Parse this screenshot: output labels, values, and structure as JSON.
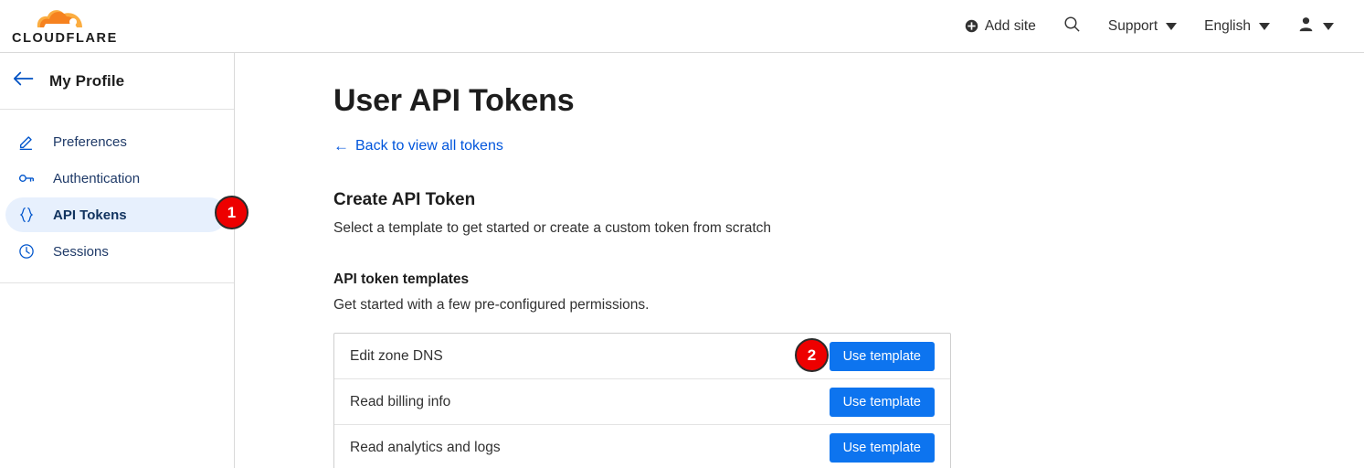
{
  "header": {
    "logo_name": "cloudflare-logo",
    "logo_text": "CLOUDFLARE",
    "logo_colors": {
      "cloud_dark": "#f6821f",
      "cloud_light": "#fbad41",
      "wordmark": "#1d1d1d"
    },
    "nav": [
      {
        "id": "add-site",
        "label": "Add site",
        "icon": "plus-circle-icon",
        "caret": false
      },
      {
        "id": "search",
        "label": "",
        "icon": "search-icon",
        "caret": false
      },
      {
        "id": "support",
        "label": "Support",
        "icon": "",
        "caret": true
      },
      {
        "id": "language",
        "label": "English",
        "icon": "",
        "caret": true
      },
      {
        "id": "account",
        "label": "",
        "icon": "user-icon",
        "caret": true
      }
    ]
  },
  "sidebar": {
    "back_icon": "arrow-left-icon",
    "title": "My Profile",
    "items": [
      {
        "id": "preferences",
        "label": "Preferences",
        "icon": "pencil-icon",
        "selected": false
      },
      {
        "id": "authentication",
        "label": "Authentication",
        "icon": "key-icon",
        "selected": false
      },
      {
        "id": "api-tokens",
        "label": "API Tokens",
        "icon": "curly-braces-icon",
        "selected": true
      },
      {
        "id": "sessions",
        "label": "Sessions",
        "icon": "clock-icon",
        "selected": false
      }
    ],
    "selected_bg": "#e7f0fd"
  },
  "main": {
    "page_title": "User API Tokens",
    "back_link": {
      "arrow": "←",
      "label": "Back to view all tokens"
    },
    "section": {
      "title": "Create API Token",
      "subtitle": "Select a template to get started or create a custom token from scratch"
    },
    "templates_section": {
      "title": "API token templates",
      "subtitle": "Get started with a few pre-configured permissions."
    },
    "templates": [
      {
        "id": "edit-zone-dns",
        "label": "Edit zone DNS",
        "button": "Use template"
      },
      {
        "id": "read-billing-info",
        "label": "Read billing info",
        "button": "Use template"
      },
      {
        "id": "read-analytics-and-logs",
        "label": "Read analytics and logs",
        "button": "Use template"
      }
    ],
    "button_color": "#0d74ef"
  },
  "annotations": {
    "badges": [
      {
        "id": "badge-1",
        "number": "1",
        "target": "sidebar-item-api-tokens"
      },
      {
        "id": "badge-2",
        "number": "2",
        "target": "use-template-button-edit-zone-dns"
      }
    ],
    "badge_color": "#ed0000"
  }
}
